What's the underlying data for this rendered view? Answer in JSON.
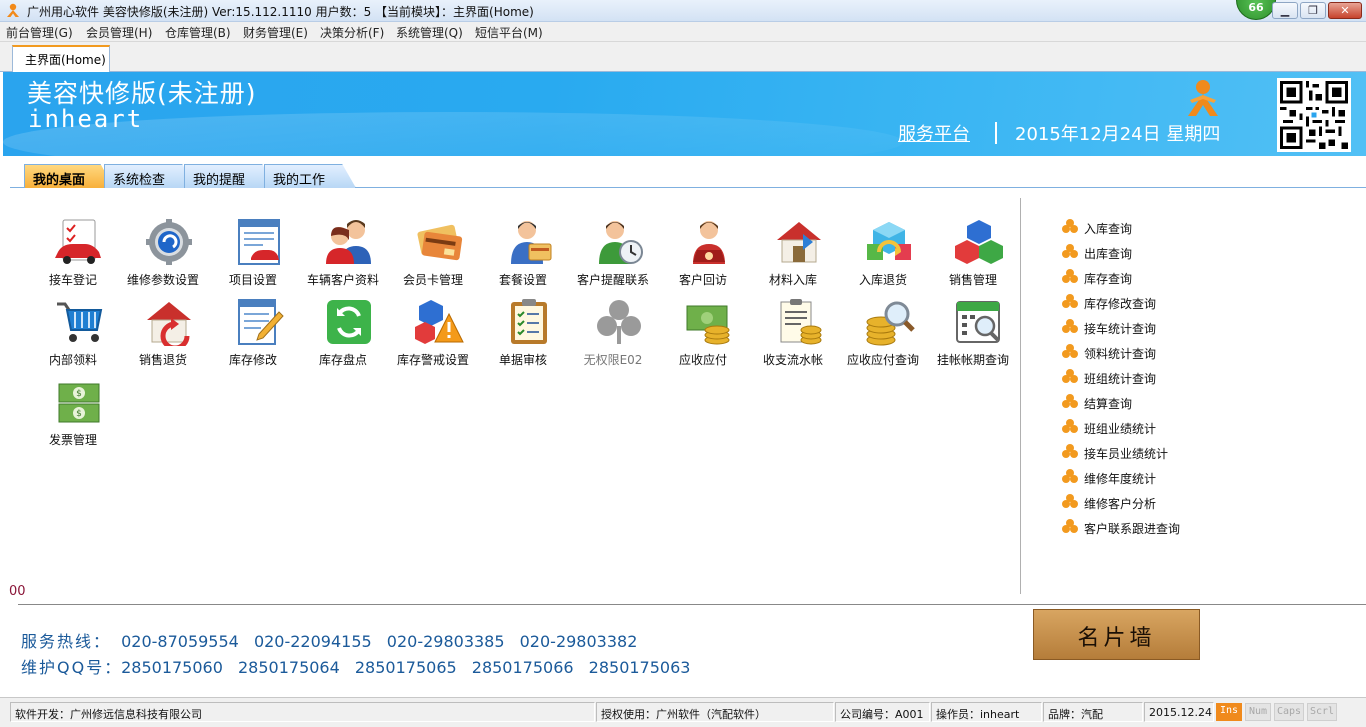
{
  "window": {
    "title": "广州用心软件 美容快修版(未注册)  Ver:15.112.1110  用户数：5  【当前模块】：主界面(Home)",
    "badge": "66",
    "min_glyph": "▁",
    "max_glyph": "❐",
    "close_glyph": "✕"
  },
  "menu": [
    "前台管理(G)",
    "会员管理(H)",
    "仓库管理(B)",
    "财务管理(E)",
    "决策分析(F)",
    "系统管理(Q)",
    "短信平台(M)"
  ],
  "doc_tab": "主界面(Home)",
  "banner": {
    "title": "美容快修版(未注册)",
    "subtitle": "inheart",
    "service_link": "服务平台",
    "date": "2015年12月24日 星期四"
  },
  "inner_tabs": [
    "我的桌面",
    "系统检查",
    "我的提醒",
    "我的工作"
  ],
  "desk_icons": [
    {
      "label": "接车登记",
      "icon": "car-checkin-icon"
    },
    {
      "label": "维修参数设置",
      "icon": "gear-params-icon"
    },
    {
      "label": "项目设置",
      "icon": "project-settings-icon"
    },
    {
      "label": "车辆客户资料",
      "icon": "customers-icon"
    },
    {
      "label": "会员卡管理",
      "icon": "member-card-icon"
    },
    {
      "label": "套餐设置",
      "icon": "package-icon"
    },
    {
      "label": "客户提醒联系",
      "icon": "reminder-icon"
    },
    {
      "label": "客户回访",
      "icon": "phone-visit-icon"
    },
    {
      "label": "材料入库",
      "icon": "warehouse-in-icon"
    },
    {
      "label": "入库退货",
      "icon": "return-in-icon"
    },
    {
      "label": "销售管理",
      "icon": "sales-cubes-icon"
    },
    {
      "label": "内部领料",
      "icon": "cart-icon"
    },
    {
      "label": "销售退货",
      "icon": "sales-return-icon"
    },
    {
      "label": "库存修改",
      "icon": "edit-doc-icon"
    },
    {
      "label": "库存盘点",
      "icon": "refresh-icon"
    },
    {
      "label": "库存警戒设置",
      "icon": "warning-icon"
    },
    {
      "label": "单据审核",
      "icon": "checklist-icon"
    },
    {
      "label": "无权限E02",
      "icon": "clover-gray-icon"
    },
    {
      "label": "应收应付",
      "icon": "money-icon"
    },
    {
      "label": "收支流水帐",
      "icon": "ledger-icon"
    },
    {
      "label": "应收应付查询",
      "icon": "coin-search-icon"
    },
    {
      "label": "挂帐帐期查询",
      "icon": "calendar-search-icon"
    },
    {
      "label": "发票管理",
      "icon": "invoice-icon"
    }
  ],
  "quick_links": [
    "入库查询",
    "出库查询",
    "库存查询",
    "库存修改查询",
    "接车统计查询",
    "领料统计查询",
    "班组统计查询",
    "结算查询",
    "班组业绩统计",
    "接车员业绩统计",
    "维修年度统计",
    "维修客户分析",
    "客户联系跟进查询"
  ],
  "marker": "00",
  "contacts": {
    "hotline_label": "服务热线：",
    "hotline_numbers": [
      "020-87059554",
      "020-22094155",
      "020-29803385",
      "020-29803382"
    ],
    "qq_label": "维护QQ号：",
    "qq_numbers": [
      "2850175060",
      "2850175064",
      "2850175065",
      "2850175066",
      "2850175063"
    ]
  },
  "card_wall": "名片墙",
  "status": {
    "developer": "软件开发：广州修远信息科技有限公司",
    "license": "授权使用：广州软件（汽配软件）",
    "company": "公司编号：A001",
    "operator": "操作员：inheart",
    "brand": "品牌：汽配",
    "date": "2015.12.24",
    "keys": [
      "Ins",
      "Num",
      "Caps",
      "Scrl"
    ]
  },
  "colors": {
    "banner": "#29aaf0",
    "accent_orange": "#f29a1f",
    "contact_blue": "#1b5a9a",
    "key_on": "#f08a1c"
  }
}
